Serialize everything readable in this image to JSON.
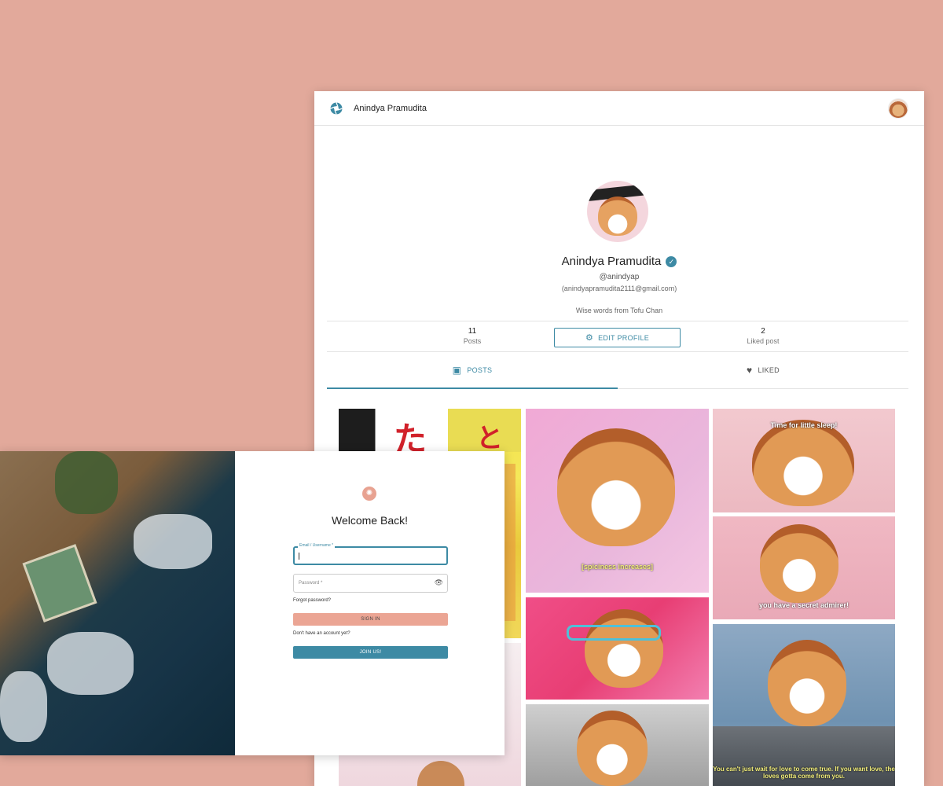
{
  "colors": {
    "background": "#e2a99b",
    "accent": "#3d8aa4",
    "signin_button": "#eba594"
  },
  "profile_app": {
    "header": {
      "title": "Anindya Pramudita",
      "logo_icon": "aperture-icon",
      "avatar_icon": "avatar"
    },
    "profile": {
      "name": "Anindya Pramudita",
      "verified_icon": "verified-badge-icon",
      "handle": "@anindyap",
      "email": "(anindyapramudita2111@gmail.com)",
      "bio": "Wise words from Tofu Chan",
      "edit_button": "EDIT PROFILE"
    },
    "stats": [
      {
        "value": "11",
        "label": "Posts"
      },
      {
        "value": "2",
        "label": "Liked post"
      }
    ],
    "tabs": [
      {
        "label": "POSTS",
        "icon": "photo-library-icon",
        "active": true
      },
      {
        "label": "LIKED",
        "icon": "heart-icon",
        "active": false
      }
    ],
    "posts": [
      {
        "caption": ""
      },
      {
        "caption": "[spiciness increases]"
      },
      {
        "caption": "Time for little sleep!"
      },
      {
        "caption": "you have a secret admirer!"
      },
      {
        "caption": ""
      },
      {
        "caption": "You can't just wait for love to come true. If you want love, the loves gotta come from you."
      },
      {
        "caption": ""
      },
      {
        "caption": ""
      }
    ]
  },
  "login": {
    "logo_icon": "aperture-icon",
    "title": "Welcome Back!",
    "email_label": "Email / Username *",
    "email_value": "",
    "password_placeholder": "Password *",
    "password_toggle_icon": "eye-icon",
    "forgot": "Forgot password?",
    "signin": "SIGN IN",
    "no_account": "Don't have an account yet?",
    "join": "JOIN US!"
  }
}
